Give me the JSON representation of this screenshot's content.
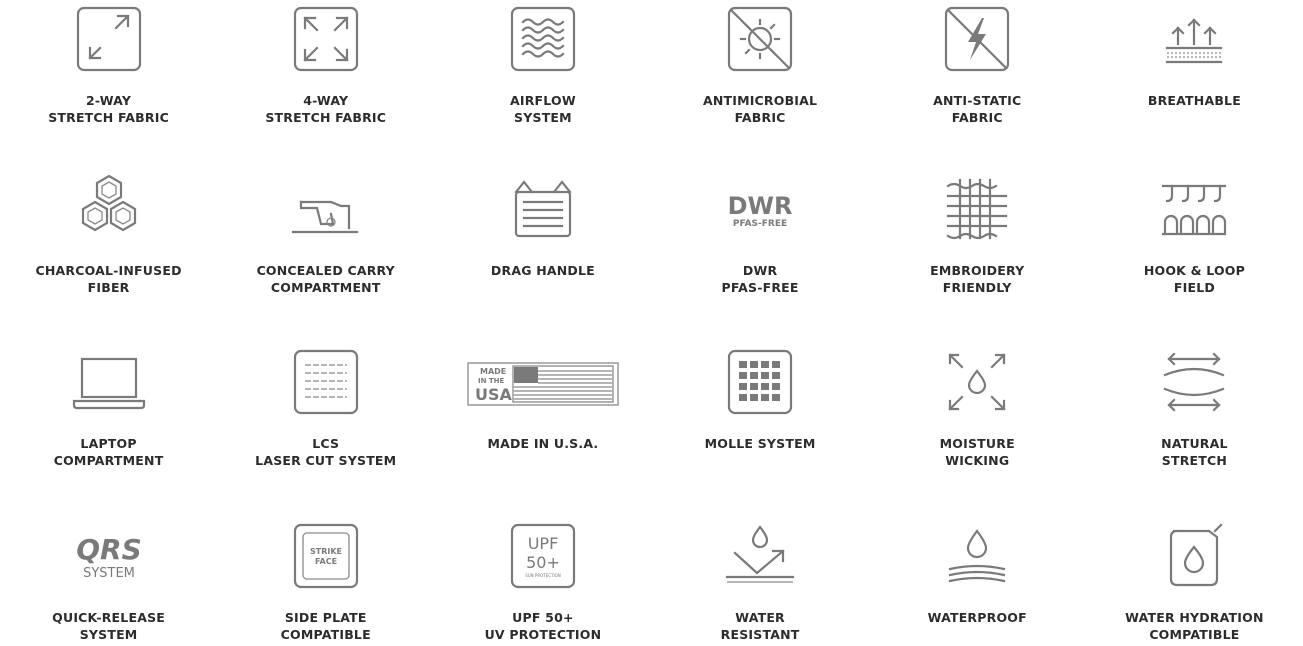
{
  "features": [
    {
      "icon": "two-way-stretch-icon",
      "lines": [
        "2-WAY",
        "STRETCH FABRIC"
      ]
    },
    {
      "icon": "four-way-stretch-icon",
      "lines": [
        "4-WAY",
        "STRETCH FABRIC"
      ]
    },
    {
      "icon": "airflow-icon",
      "lines": [
        "AIRFLOW",
        "SYSTEM"
      ]
    },
    {
      "icon": "antimicrobial-icon",
      "lines": [
        "ANTIMICROBIAL",
        "FABRIC"
      ]
    },
    {
      "icon": "anti-static-icon",
      "lines": [
        "ANTI-STATIC",
        "FABRIC"
      ]
    },
    {
      "icon": "breathable-icon",
      "lines": [
        "BREATHABLE"
      ]
    },
    {
      "icon": "charcoal-hexagon-icon",
      "lines": [
        "CHARCOAL-INFUSED",
        "FIBER"
      ]
    },
    {
      "icon": "concealed-carry-icon",
      "lines": [
        "CONCEALED CARRY",
        "COMPARTMENT"
      ]
    },
    {
      "icon": "drag-handle-icon",
      "lines": [
        "DRAG HANDLE"
      ]
    },
    {
      "icon": "dwr-icon",
      "lines": [
        "DWR",
        "PFAS-FREE"
      ]
    },
    {
      "icon": "embroidery-icon",
      "lines": [
        "EMBROIDERY",
        "FRIENDLY"
      ]
    },
    {
      "icon": "hook-loop-icon",
      "lines": [
        "HOOK & LOOP",
        "FIELD"
      ]
    },
    {
      "icon": "laptop-icon",
      "lines": [
        "LAPTOP",
        "COMPARTMENT"
      ]
    },
    {
      "icon": "laser-cut-icon",
      "lines": [
        "LCS",
        "LASER CUT SYSTEM"
      ]
    },
    {
      "icon": "usa-flag-icon",
      "lines": [
        "MADE IN U.S.A."
      ]
    },
    {
      "icon": "molle-grid-icon",
      "lines": [
        "MOLLE SYSTEM"
      ]
    },
    {
      "icon": "moisture-wicking-icon",
      "lines": [
        "MOISTURE",
        "WICKING"
      ]
    },
    {
      "icon": "natural-stretch-icon",
      "lines": [
        "NATURAL",
        "STRETCH"
      ]
    },
    {
      "icon": "qrs-system-icon",
      "lines": [
        "QUICK-RELEASE",
        "SYSTEM"
      ]
    },
    {
      "icon": "side-plate-icon",
      "lines": [
        "SIDE PLATE",
        "COMPATIBLE"
      ]
    },
    {
      "icon": "upf-icon",
      "lines": [
        "UPF 50+",
        "UV PROTECTION"
      ]
    },
    {
      "icon": "water-resistant-icon",
      "lines": [
        "WATER",
        "RESISTANT"
      ]
    },
    {
      "icon": "waterproof-icon",
      "lines": [
        "WATERPROOF"
      ]
    },
    {
      "icon": "water-hydration-icon",
      "lines": [
        "WATER HYDRATION",
        "COMPATIBLE"
      ]
    }
  ],
  "icon_text": {
    "dwr": "DWR",
    "pfas": "PFAS-FREE",
    "made": "MADE",
    "in_the": "IN THE",
    "usa": "USA",
    "qrs": "QRS",
    "system": "SYSTEM",
    "strike": "STRIKE",
    "face": "FACE",
    "upf": "UPF",
    "fifty": "50+",
    "sun": "SUN PROTECTION"
  },
  "colors": {
    "icon": "#7a7a7a",
    "text": "#2c2c2c"
  }
}
